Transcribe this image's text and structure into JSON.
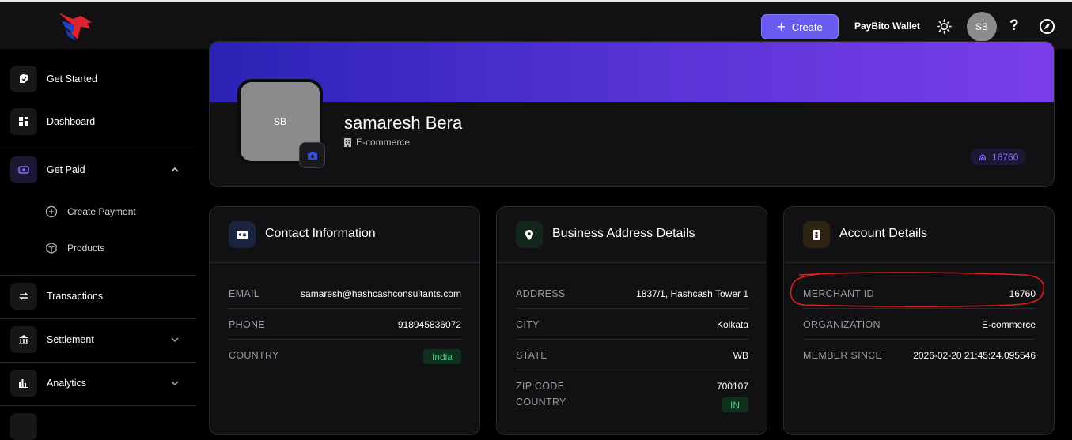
{
  "topbar": {
    "create_label": "Create",
    "wallet_label": "PayBito Wallet",
    "avatar_initials": "SB",
    "help_label": "?"
  },
  "sidebar": {
    "items": [
      {
        "label": "Get Started",
        "icon": "rocket-icon"
      },
      {
        "label": "Dashboard",
        "icon": "dashboard-icon"
      },
      {
        "label": "Get Paid",
        "icon": "wallet-icon"
      },
      {
        "label": "Create Payment",
        "icon": "plus-circle-icon"
      },
      {
        "label": "Products",
        "icon": "box-icon"
      },
      {
        "label": "Transactions",
        "icon": "transfer-icon"
      },
      {
        "label": "Settlement",
        "icon": "bank-icon"
      },
      {
        "label": "Analytics",
        "icon": "chart-icon"
      }
    ]
  },
  "profile": {
    "avatar_initials": "SB",
    "name": "samaresh Bera",
    "organization": "E-commerce",
    "merchant_badge": "16760"
  },
  "contact": {
    "title": "Contact Information",
    "rows": [
      {
        "key": "EMAIL",
        "value": "samaresh@hashcashconsultants.com"
      },
      {
        "key": "PHONE",
        "value": "918945836072"
      },
      {
        "key": "COUNTRY",
        "value": "India"
      }
    ]
  },
  "address": {
    "title": "Business Address Details",
    "rows": [
      {
        "key": "ADDRESS",
        "value": "1837/1, Hashcash Tower 1"
      },
      {
        "key": "CITY",
        "value": "Kolkata"
      },
      {
        "key": "STATE",
        "value": "WB"
      },
      {
        "key": "ZIP CODE",
        "value": "700107"
      },
      {
        "key": "COUNTRY",
        "value": "IN"
      }
    ]
  },
  "account": {
    "title": "Account Details",
    "rows": [
      {
        "key": "MERCHANT ID",
        "value": "16760"
      },
      {
        "key": "ORGANIZATION",
        "value": "E-commerce"
      },
      {
        "key": "MEMBER SINCE",
        "value": "2026-02-20 21:45:24.095546"
      }
    ]
  },
  "colors": {
    "accent": "#6a5cf0",
    "banner_start": "#2a22b5",
    "banner_end": "#7a3ee8",
    "success": "#3dd07a",
    "annotation": "#e01e1e"
  }
}
